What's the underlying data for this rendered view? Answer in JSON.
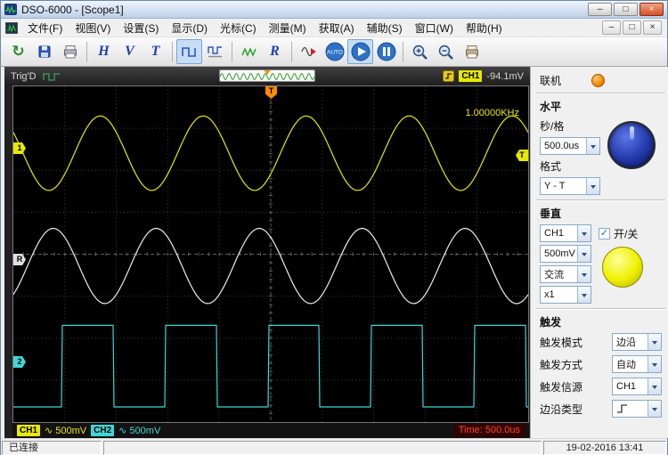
{
  "window": {
    "title": "DSO-6000 - [Scope1]",
    "controls": {
      "minimize": "–",
      "maximize": "□",
      "close": "×"
    }
  },
  "menu": {
    "items": [
      "文件(F)",
      "视图(V)",
      "设置(S)",
      "显示(D)",
      "光标(C)",
      "测量(M)",
      "获取(A)",
      "辅助(S)",
      "窗口(W)",
      "帮助(H)"
    ],
    "mdi": {
      "minimize": "–",
      "restore": "□",
      "close": "×"
    }
  },
  "toolbar": {
    "connect_glyph": "↻",
    "h_label": "H",
    "v_label": "V",
    "t_label": "T",
    "r_label": "R",
    "auto_label": "AUTO"
  },
  "scope": {
    "trig_status": "Trig'D",
    "trigger_channel": "CH1",
    "trigger_level": "-94.1mV",
    "frequency": "1.00000KHz",
    "markers": {
      "ch1": "1",
      "ref": "R",
      "ch2": "2",
      "trig": "T",
      "trig_top": "T"
    },
    "footer": {
      "ch1_label": "CH1",
      "ch1_value": "∿ 500mV",
      "ch2_label": "CH2",
      "ch2_value": "∿ 500mV",
      "time": "Time: 500.0us"
    }
  },
  "panel": {
    "online_label": "联机",
    "horizontal": {
      "title": "水平",
      "sec_div_label": "秒/格",
      "sec_div_value": "500.0us",
      "format_label": "格式",
      "format_value": "Y - T"
    },
    "vertical": {
      "title": "垂直",
      "channel_value": "CH1",
      "onoff_label": "开/关",
      "check_glyph": "✓",
      "scale_value": "500mV",
      "coupling_value": "交流",
      "probe_value": "x1"
    },
    "trigger": {
      "title": "触发",
      "mode_label": "触发模式",
      "mode_value": "边沿",
      "sweep_label": "触发方式",
      "sweep_value": "自动",
      "source_label": "触发信源",
      "source_value": "CH1",
      "edge_label": "边沿类型"
    }
  },
  "statusbar": {
    "connection": "已连接",
    "datetime": "19-02-2016  13:41"
  },
  "colors": {
    "ch1": "#e8e800",
    "ch2": "#3fd6d6",
    "ref": "#ececec",
    "time_text": "#ff4a2a",
    "trigger_marker": "#ff8a00",
    "online_led": "#f08800"
  },
  "waveforms": {
    "grid": {
      "cols": 10,
      "rows": 8
    },
    "series": [
      {
        "name": "ch1-sine",
        "type": "sine",
        "color": "#e8e800",
        "cycles": 5,
        "center_frac": 0.199,
        "amplitude_frac": 0.111,
        "phase": 2.55
      },
      {
        "name": "ref-sine",
        "type": "sine",
        "color": "#ececec",
        "cycles": 5,
        "center_frac": 0.535,
        "amplitude_frac": 0.112,
        "phase": 5.42
      },
      {
        "name": "ch2-square",
        "type": "square",
        "color": "#3fd6d6",
        "cycles": 5,
        "high_frac": 0.712,
        "low_frac": 0.955,
        "phase": 3.3
      }
    ],
    "preview": {
      "type": "sine",
      "color": "#2f9e2f",
      "cycles": 13,
      "center": 7,
      "amplitude": 3.5,
      "phase": 0
    }
  }
}
